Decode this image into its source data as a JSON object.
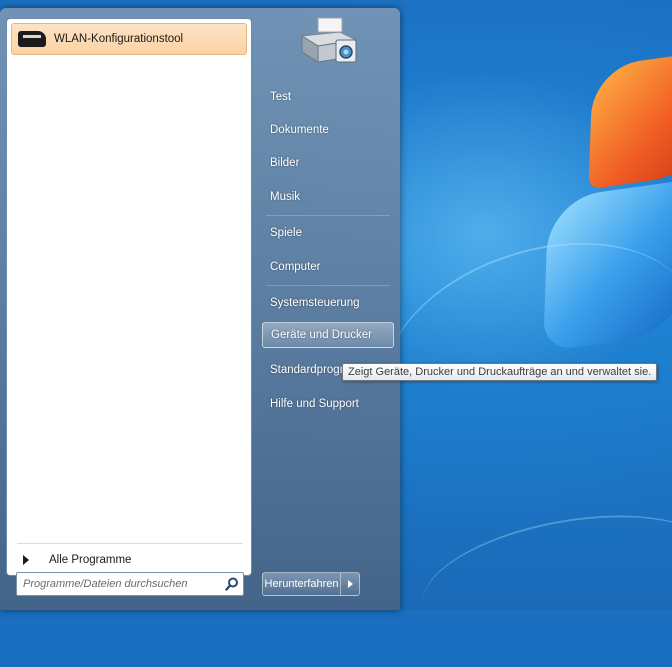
{
  "start_menu": {
    "pinned_programs": [
      {
        "label": "WLAN-Konfigurationstool",
        "icon": "wlan-tool-icon"
      }
    ],
    "all_programs_label": "Alle Programme",
    "search": {
      "placeholder": "Programme/Dateien durchsuchen",
      "value": ""
    },
    "right_pane": {
      "items": [
        {
          "label": "Test"
        },
        {
          "label": "Dokumente"
        },
        {
          "label": "Bilder"
        },
        {
          "label": "Musik"
        },
        {
          "label": "Spiele"
        },
        {
          "label": "Computer"
        },
        {
          "label": "Systemsteuerung"
        },
        {
          "label": "Geräte und Drucker",
          "highlighted": true
        },
        {
          "label": "Standardprogr"
        },
        {
          "label": "Hilfe und Support"
        }
      ]
    },
    "shutdown": {
      "label": "Herunterfahren"
    }
  },
  "tooltip": {
    "text": "Zeigt Geräte, Drucker und Druckaufträge an und verwaltet sie."
  },
  "colors": {
    "pinned_highlight": "#fbd2a3",
    "menu_frame": "#5a7a9e",
    "desktop": "#1d83d3"
  }
}
